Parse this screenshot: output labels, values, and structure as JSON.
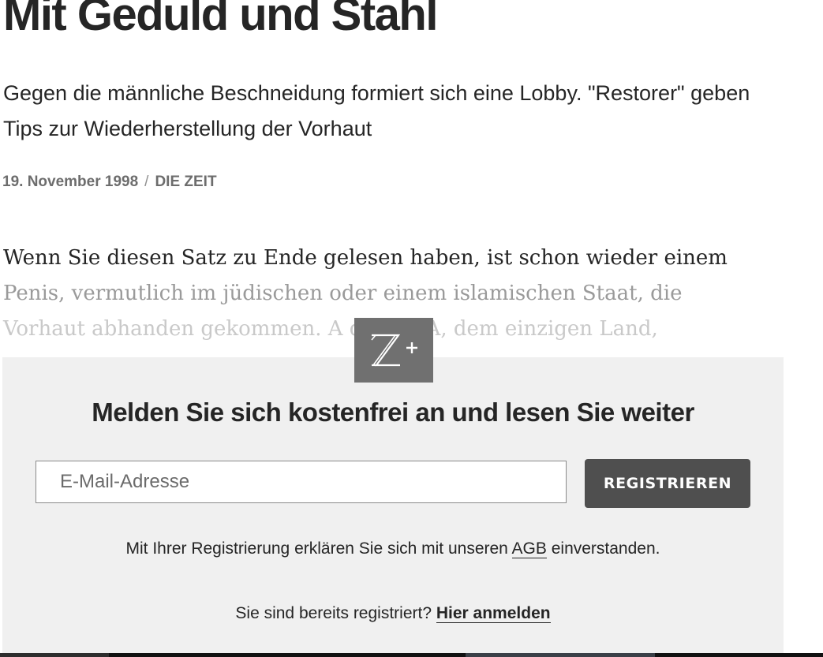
{
  "article": {
    "title": "Mit Geduld und Stahl",
    "summary": "Gegen die männliche Beschneidung formiert sich eine Lobby. \"Restorer\" geben Tips zur Wiederherstellung der Vorhaut",
    "date": "19. November 1998",
    "separator": "/",
    "source": "DIE ZEIT",
    "body_lines": [
      "Wenn Sie diesen Satz zu Ende gelesen haben, ist schon wieder einem",
      "Penis, vermutlich im jüdischen oder einem islamischen Staat, die",
      "Vorhaut abhanden gekommen. A          den USA, dem einzigen Land,"
    ]
  },
  "badge": {
    "icon": "zplus-icon",
    "text": "Z+"
  },
  "paywall": {
    "heading": "Melden Sie sich kostenfrei an und lesen Sie weiter",
    "email_placeholder": "E-Mail-Adresse",
    "email_value": "",
    "register_label": "REGISTRIEREN",
    "terms_before": "Mit Ihrer Registrierung erklären Sie sich mit unseren ",
    "terms_link": "AGB",
    "terms_after": " einverstanden.",
    "login_prompt": "Sie sind bereits registriert? ",
    "login_link": "Hier anmelden"
  },
  "colors": {
    "paywall_background": "#f0f0f0",
    "button_background": "#4f4f4f",
    "badge_background": "#707070",
    "text": "#252525"
  }
}
